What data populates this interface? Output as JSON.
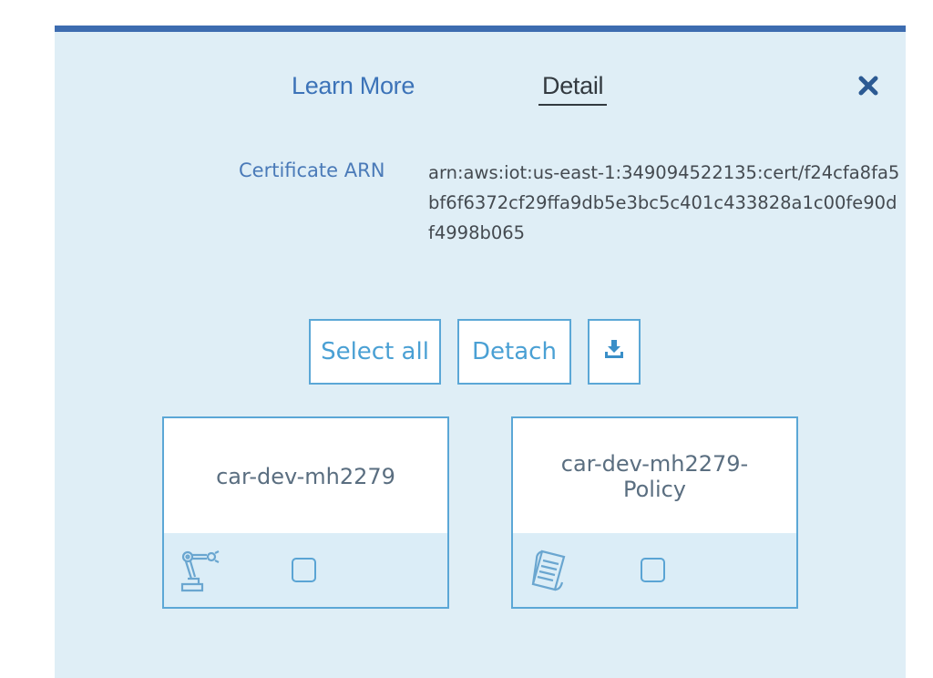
{
  "tabs": {
    "learn_more": "Learn More",
    "detail": "Detail"
  },
  "close_icon": "close-icon",
  "certificate": {
    "label": "Certificate ARN",
    "value": "arn:aws:iot:us-east-1:349094522135:cert/f24cfa8fa5bf6f6372cf29ffa9db5e3bc5c401c433828a1c00fe90df4998b065"
  },
  "actions": {
    "select_all": "Select all",
    "detach": "Detach",
    "download_icon": "download-icon"
  },
  "cards": [
    {
      "title": "car-dev-mh2279",
      "icon": "thing-robot-arm-icon",
      "checked": false
    },
    {
      "title": "car-dev-mh2279-Policy",
      "icon": "policy-document-icon",
      "checked": false
    }
  ],
  "colors": {
    "accent": "#3d6cb0",
    "panel_bg": "#dfeef6",
    "border": "#5ba7d6"
  }
}
